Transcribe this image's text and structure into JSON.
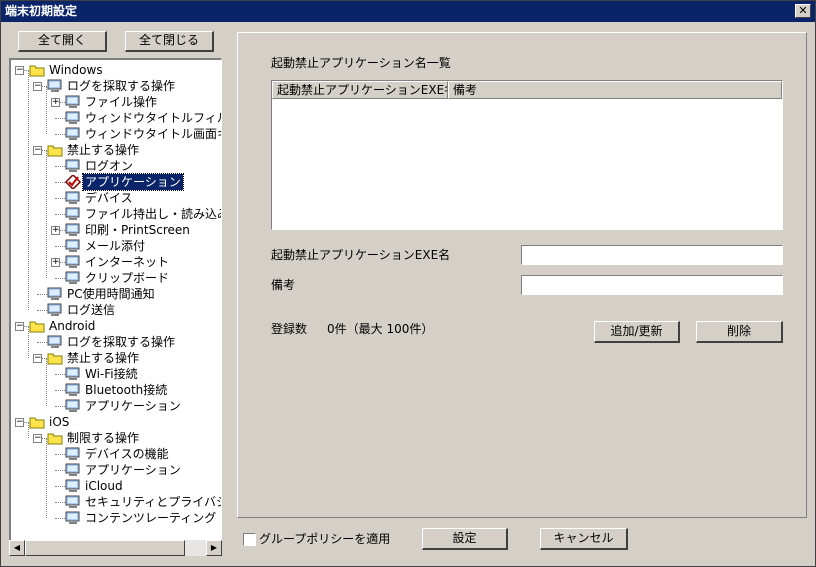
{
  "window": {
    "title": "端末初期設定",
    "close_glyph": "✕"
  },
  "tree_buttons": {
    "expand_all": "全て開く",
    "collapse_all": "全て閉じる"
  },
  "tree": [
    {
      "label": "Windows",
      "icon": "folder-icon",
      "expander": "minus"
    },
    {
      "label": "ログを採取する操作",
      "icon": "computer-icon",
      "expander": "minus"
    },
    {
      "label": "ファイル操作",
      "icon": "computer-icon",
      "expander": "plus"
    },
    {
      "label": "ウィンドウタイトルフィルタ",
      "icon": "computer-icon",
      "expander": ""
    },
    {
      "label": "ウィンドウタイトル画面キャ",
      "icon": "computer-icon",
      "expander": ""
    },
    {
      "label": "禁止する操作",
      "icon": "folder-icon",
      "expander": "minus"
    },
    {
      "label": "ログオン",
      "icon": "computer-icon",
      "expander": ""
    },
    {
      "label": "アプリケーション",
      "icon": "checked-item-icon",
      "expander": "",
      "selected": true
    },
    {
      "label": "デバイス",
      "icon": "computer-icon",
      "expander": ""
    },
    {
      "label": "ファイル持出し・読み込み",
      "icon": "computer-icon",
      "expander": ""
    },
    {
      "label": "印刷・PrintScreen",
      "icon": "computer-icon",
      "expander": "plus"
    },
    {
      "label": "メール添付",
      "icon": "computer-icon",
      "expander": ""
    },
    {
      "label": "インターネット",
      "icon": "computer-icon",
      "expander": "plus"
    },
    {
      "label": "クリップボード",
      "icon": "computer-icon",
      "expander": ""
    },
    {
      "label": "PC使用時間通知",
      "icon": "computer-icon",
      "expander": ""
    },
    {
      "label": "ログ送信",
      "icon": "computer-icon",
      "expander": ""
    },
    {
      "label": "Android",
      "icon": "folder-icon",
      "expander": "minus"
    },
    {
      "label": "ログを採取する操作",
      "icon": "computer-icon",
      "expander": ""
    },
    {
      "label": "禁止する操作",
      "icon": "folder-icon",
      "expander": "minus"
    },
    {
      "label": "Wi-Fi接続",
      "icon": "computer-icon",
      "expander": ""
    },
    {
      "label": "Bluetooth接続",
      "icon": "computer-icon",
      "expander": ""
    },
    {
      "label": "アプリケーション",
      "icon": "computer-icon",
      "expander": ""
    },
    {
      "label": "iOS",
      "icon": "folder-icon",
      "expander": "minus"
    },
    {
      "label": "制限する操作",
      "icon": "folder-icon",
      "expander": "minus"
    },
    {
      "label": "デバイスの機能",
      "icon": "computer-icon",
      "expander": ""
    },
    {
      "label": "アプリケーション",
      "icon": "computer-icon",
      "expander": ""
    },
    {
      "label": "iCloud",
      "icon": "computer-icon",
      "expander": ""
    },
    {
      "label": "セキュリティとプライバシー",
      "icon": "computer-icon",
      "expander": ""
    },
    {
      "label": "コンテンツレーティング",
      "icon": "computer-icon",
      "expander": ""
    }
  ],
  "scrollbar": {
    "left_glyph": "◀",
    "right_glyph": "▶"
  },
  "main": {
    "list_title": "起動禁止アプリケーション名一覧",
    "columns": [
      "起動禁止アプリケーションEXE名",
      "備考"
    ],
    "exe_label": "起動禁止アプリケーションEXE名",
    "exe_value": "",
    "note_label": "備考",
    "note_value": "",
    "count_label": "登録数",
    "count_value": "0件（最大 100件）",
    "add_update_button": "追加/更新",
    "delete_button": "削除"
  },
  "footer": {
    "group_policy_label": "グループポリシーを適用",
    "group_policy_checked": false,
    "settings_button": "設定",
    "cancel_button": "キャンセル"
  },
  "colors": {
    "title_bar": "#0a246a",
    "face": "#d4d0c8",
    "selection": "#0a246a",
    "folder": "#ffe24c"
  }
}
